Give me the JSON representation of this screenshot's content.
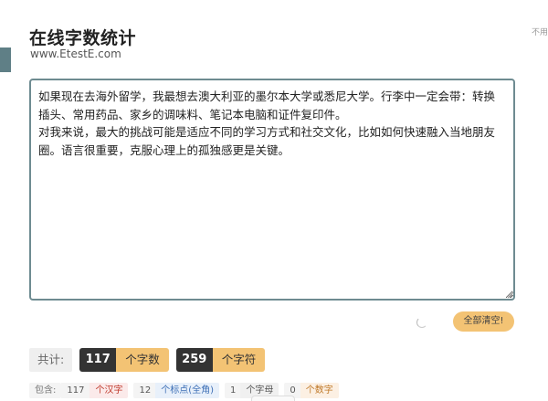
{
  "header": {
    "title": "在线字数统计",
    "url": "www.EtestE.com",
    "top_right": "不用"
  },
  "editor": {
    "value": "如果现在去海外留学，我最想去澳大利亚的墨尔本大学或悉尼大学。行李中一定会带：转换插头、常用药品、家乡的调味料、笔记本电脑和证件复印件。\n对我来说，最大的挑战可能是适应不同的学习方式和社交文化，比如如何快速融入当地朋友圈。语言很重要，克服心理上的孤独感更是关键。"
  },
  "actions": {
    "clear_label": "全部清空!"
  },
  "totals": {
    "label": "共计:",
    "char_count": "117",
    "char_unit": "个字数",
    "symbol_count": "259",
    "symbol_unit": "个字符"
  },
  "breakdown": {
    "label": "包含:",
    "items": [
      {
        "count": "117",
        "label": "个汉字"
      },
      {
        "count": "12",
        "label": "个标点(全角)"
      },
      {
        "count": "1",
        "label": "个字母"
      },
      {
        "count": "0",
        "label": "个数字"
      }
    ]
  },
  "colors": {
    "accent": "#f3c374",
    "editor_border": "#6e8b91",
    "dark_badge": "#333333"
  }
}
